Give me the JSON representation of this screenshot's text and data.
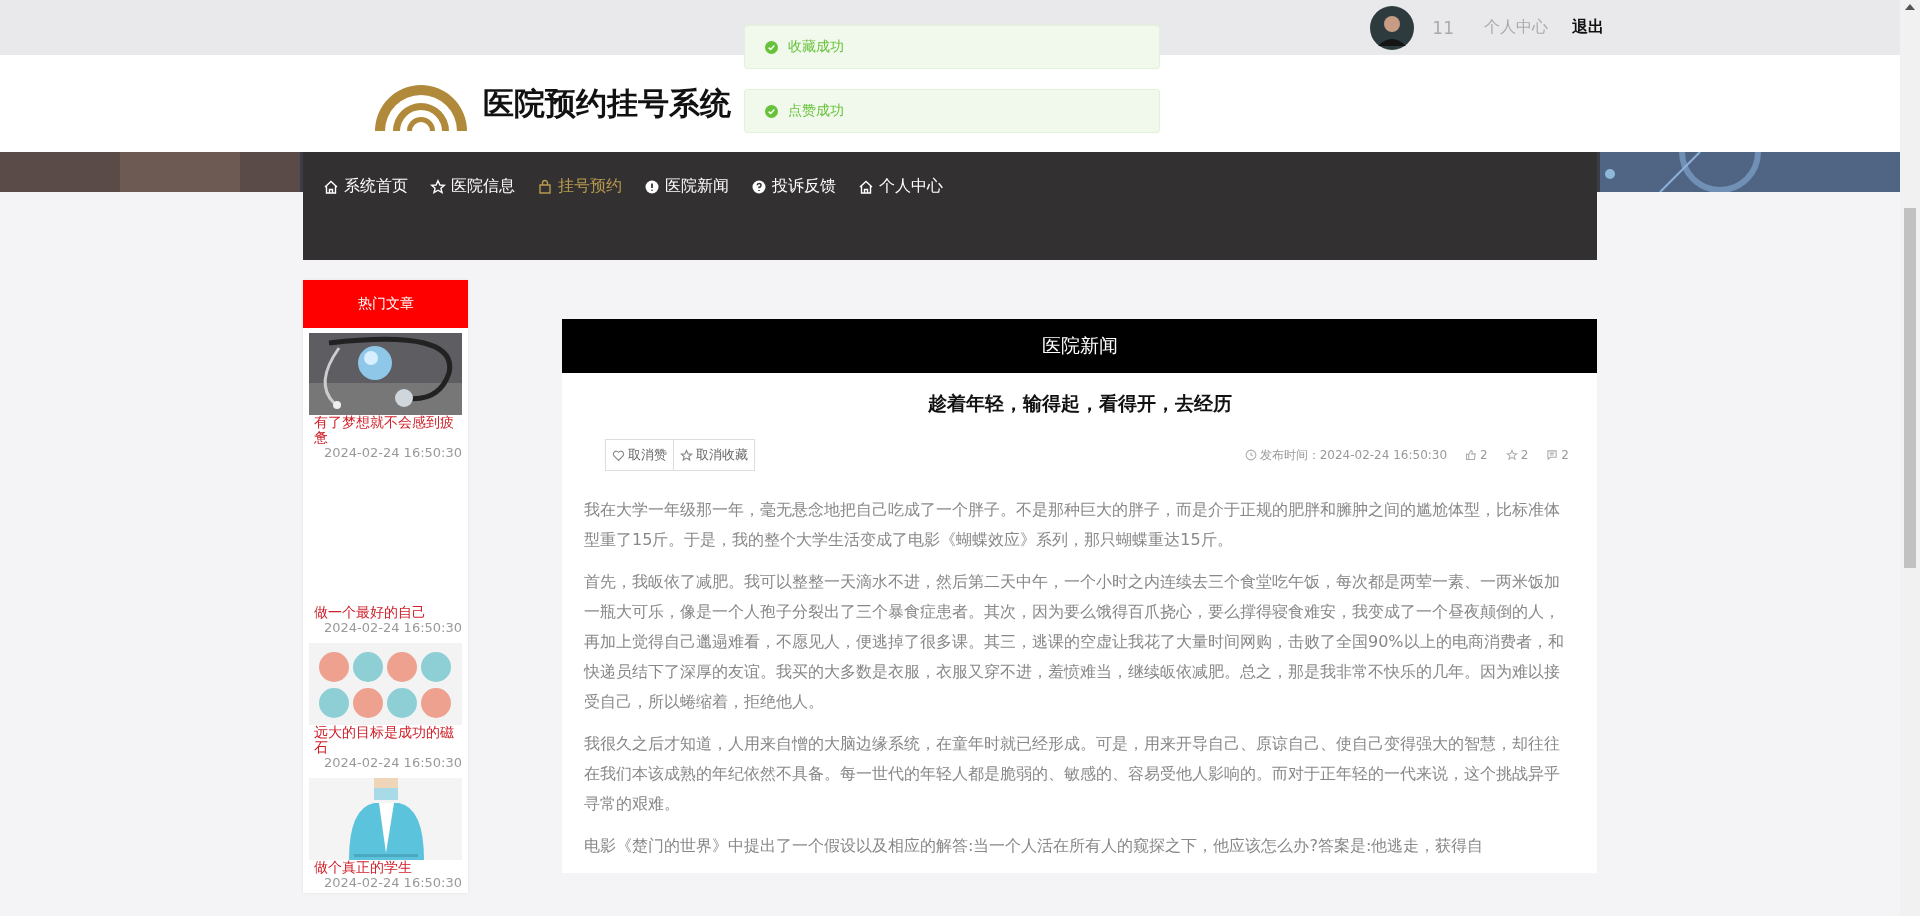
{
  "top_bar": {
    "user_name": "11",
    "links": [
      {
        "label": "个人中心",
        "kind": "plain"
      },
      {
        "label": "退出",
        "kind": "strong"
      }
    ]
  },
  "toasts": [
    {
      "text": "收藏成功"
    },
    {
      "text": "点赞成功"
    }
  ],
  "header": {
    "title": "医院预约挂号系统"
  },
  "nav": [
    {
      "label": "系统首页",
      "selected": false
    },
    {
      "label": "医院信息",
      "selected": false
    },
    {
      "label": "挂号预约",
      "selected": true
    },
    {
      "label": "医院新闻",
      "selected": false
    },
    {
      "label": "投诉反馈",
      "selected": false
    },
    {
      "label": "个人中心",
      "selected": false
    }
  ],
  "sidebar": {
    "title": "热门文章",
    "articles": [
      {
        "kind": "picture",
        "title": "有了梦想就不会感到疲惫",
        "date": "2024-02-24 16:50:30"
      },
      {
        "kind": "empty",
        "title": "做一个最好的自己",
        "date": "2024-02-24 16:50:30"
      },
      {
        "kind": "picture",
        "title": "远大的目标是成功的磁石",
        "date": "2024-02-24 16:50:30"
      },
      {
        "kind": "picture",
        "title": "做个真正的学生",
        "date": "2024-02-24 16:50:30"
      }
    ]
  },
  "article": {
    "section": "医院新闻",
    "title": "趁着年轻，输得起，看得开，去经历",
    "actions": [
      {
        "label": "取消赞"
      },
      {
        "label": "取消收藏"
      }
    ],
    "published": "发布时间：2024-02-24 16:50:30",
    "likes": "2",
    "favorites": "2",
    "comments": "2",
    "paragraphs": [
      "我在大学一年级那一年，毫无悬念地把自己吃成了一个胖子。不是那种巨大的胖子，而是介于正规的肥胖和臃肿之间的尴尬体型，比标准体型重了15斤。于是，我的整个大学生活变成了电影《蝴蝶效应》系列，那只蝴蝶重达15斤。",
      "首先，我皈依了减肥。我可以整整一天滴水不进，然后第二天中午，一个小时之内连续去三个食堂吃午饭，每次都是两荤一素、一两米饭加一瓶大可乐，像是一个人孢子分裂出了三个暴食症患者。其次，因为要么饿得百爪挠心，要么撑得寝食难安，我变成了一个昼夜颠倒的人，再加上觉得自己邋遢难看，不愿见人，便逃掉了很多课。其三，逃课的空虚让我花了大量时间网购，击败了全国90%以上的电商消费者，和快递员结下了深厚的友谊。我买的大多数是衣服，衣服又穿不进，羞愤难当，继续皈依减肥。总之，那是我非常不快乐的几年。因为难以接受自己，所以蜷缩着，拒绝他人。",
      "我很久之后才知道，人用来自憎的大脑边缘系统，在童年时就已经形成。可是，用来开导自己、原谅自己、使自己变得强大的智慧，却往往在我们本该成熟的年纪依然不具备。每一世代的年轻人都是脆弱的、敏感的、容易受他人影响的。而对于正年轻的一代来说，这个挑战异乎寻常的艰难。",
      "电影《楚门的世界》中提出了一个假设以及相应的解答:当一个人活在所有人的窥探之下，他应该怎么办?答案是:他逃走，获得自"
    ]
  }
}
